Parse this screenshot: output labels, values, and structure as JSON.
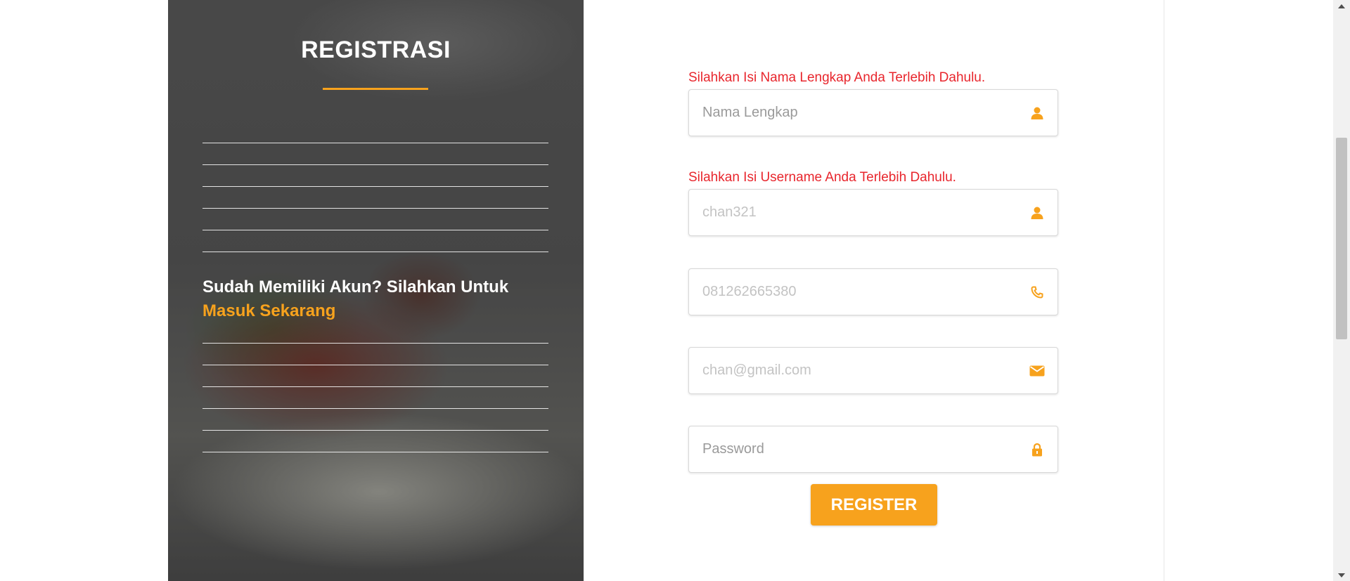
{
  "left_panel": {
    "title": "REGISTRASI",
    "login_prompt_text": "Sudah Memiliki Akun? Silahkan Untuk ",
    "login_link": "Masuk Sekarang"
  },
  "form": {
    "fields": [
      {
        "name": "full-name",
        "error": "Silahkan Isi Nama Lengkap Anda Terlebih Dahulu.",
        "placeholder": "Nama Lengkap",
        "icon": "user-icon"
      },
      {
        "name": "username",
        "error": "Silahkan Isi Username Anda Terlebih Dahulu.",
        "placeholder": "chan321",
        "icon": "user-icon"
      },
      {
        "name": "phone",
        "placeholder": "081262665380",
        "icon": "phone-icon"
      },
      {
        "name": "email",
        "placeholder": "chan@gmail.com",
        "icon": "envelope-icon"
      },
      {
        "name": "password",
        "placeholder": "Password",
        "icon": "lock-icon"
      }
    ],
    "register_label": "REGISTER"
  },
  "colors": {
    "accent": "#f7a21d",
    "error": "#e8262d",
    "panel_dark": "#555555"
  }
}
